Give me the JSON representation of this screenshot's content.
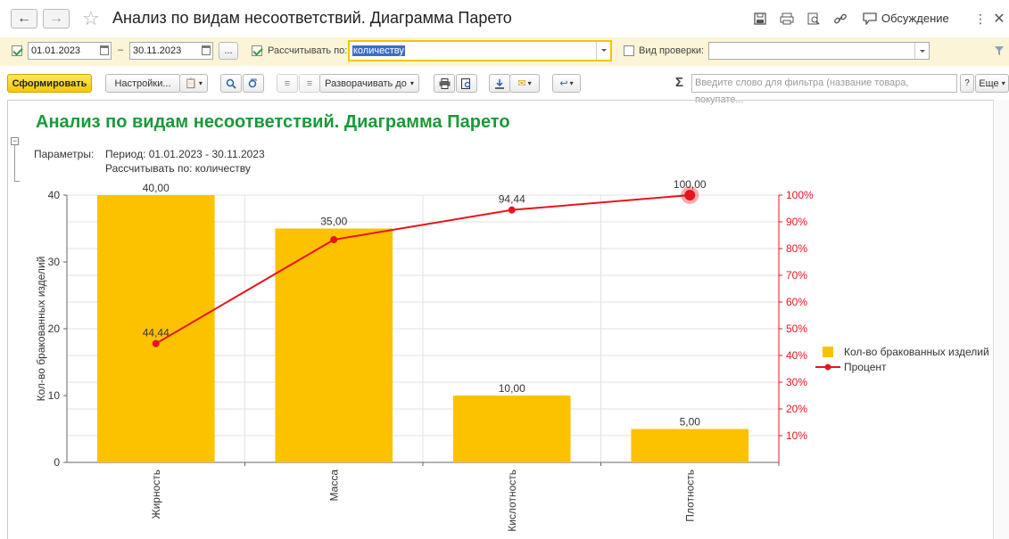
{
  "window": {
    "title": "Анализ по видам несоответствий. Диаграмма Парето",
    "discussion_label": "Обсуждение"
  },
  "filters": {
    "period_enabled": true,
    "date_from": "01.01.2023",
    "date_to": "30.11.2023",
    "dash": "–",
    "more_label": "...",
    "calc_enabled": true,
    "calc_label": "Рассчитывать по:",
    "calc_value": "количеству",
    "check_type_enabled": false,
    "check_type_label": "Вид проверки:",
    "check_type_value": ""
  },
  "toolbar": {
    "generate_label": "Сформировать",
    "settings_label": "Настройки...",
    "expand_label": "Разворачивать до",
    "search_placeholder": "Введите слово для фильтра (название товара, покупате...",
    "help_label": "?",
    "more_label": "Еще",
    "sum_symbol": "Σ"
  },
  "report": {
    "title": "Анализ по видам несоответствий. Диаграмма Парето",
    "params_label": "Параметры:",
    "param_period": "Период: 01.01.2023 - 30.11.2023",
    "param_calc": "Рассчитывать по: количеству"
  },
  "chart_data": {
    "type": "bar",
    "categories": [
      "Жирность",
      "Масса",
      "Кислотность",
      "Плотность"
    ],
    "series": [
      {
        "name": "Кол-во бракованных изделий",
        "kind": "bar",
        "color": "#fcc200",
        "values": [
          40,
          35,
          10,
          5
        ],
        "labels": [
          "40,00",
          "35,00",
          "10,00",
          "5,00"
        ]
      },
      {
        "name": "Процент",
        "kind": "line",
        "color": "#e8141b",
        "values": [
          44.44,
          83.33,
          94.44,
          100
        ],
        "labels": [
          "44,44",
          "",
          "94,44",
          "100,00"
        ]
      }
    ],
    "ylabel": "Кол-во бракованных изделий",
    "ylim": [
      0,
      40
    ],
    "yticks": [
      "0",
      "10",
      "20",
      "30",
      "40"
    ],
    "y2lim": [
      0,
      100
    ],
    "y2ticks": [
      "10%",
      "20%",
      "30%",
      "40%",
      "50%",
      "60%",
      "70%",
      "80%",
      "90%",
      "100%"
    ],
    "grid": true,
    "legend": "right"
  },
  "colors": {
    "accent_green": "#1a9a3a",
    "filter_bg": "#fbf4d7",
    "primary_button": "#f6c800"
  }
}
